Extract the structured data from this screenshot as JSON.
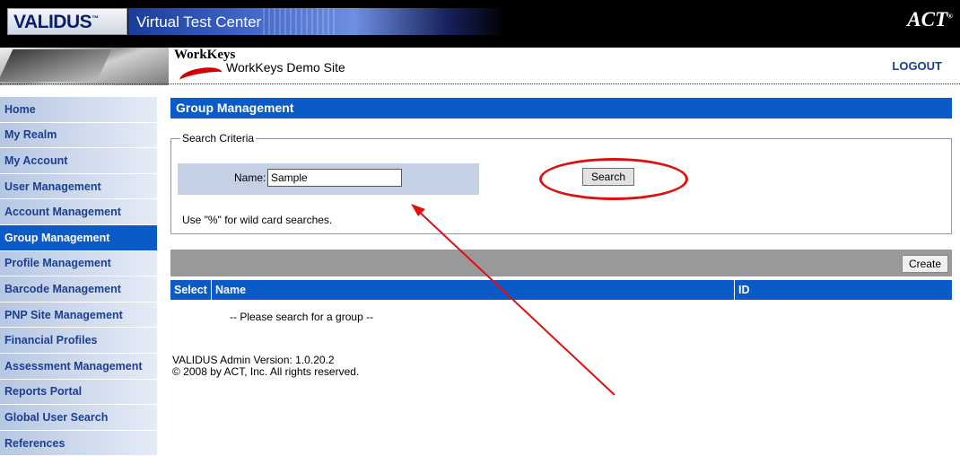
{
  "header": {
    "logo_text": "VALIDUS",
    "logo_tm": "™",
    "app_title": "Virtual Test Center",
    "act_logo": "ACT",
    "act_reg": "®",
    "brand": "WorkKeys",
    "site_name": "WorkKeys Demo Site",
    "logout_label": "LOGOUT"
  },
  "sidebar": {
    "items": [
      {
        "label": "Home"
      },
      {
        "label": "My Realm"
      },
      {
        "label": "My Account"
      },
      {
        "label": "User Management"
      },
      {
        "label": "Account Management"
      },
      {
        "label": "Group Management",
        "active": true
      },
      {
        "label": "Profile Management"
      },
      {
        "label": "Barcode Management"
      },
      {
        "label": "PNP Site Management"
      },
      {
        "label": "Financial Profiles"
      },
      {
        "label": "Assessment Management"
      },
      {
        "label": "Reports Portal"
      },
      {
        "label": "Global User Search"
      },
      {
        "label": "References"
      }
    ]
  },
  "main": {
    "page_title": "Group Management",
    "search": {
      "legend": "Search Criteria",
      "name_label": "Name:",
      "name_value": "Sample",
      "search_button": "Search",
      "wildcard_hint": "Use \"%\" for wild card searches."
    },
    "results": {
      "create_button": "Create",
      "columns": [
        "Select",
        "Name",
        "ID"
      ],
      "empty_message": "-- Please search for a group --"
    },
    "footer": {
      "version": "VALIDUS Admin Version: 1.0.20.2",
      "copyright": "© 2008 by ACT, Inc. All rights reserved."
    }
  },
  "colors": {
    "primary_blue": "#0a5ac8",
    "nav_text": "#1b3f94",
    "annotation_red": "#e01010",
    "toolbar_gray": "#999999"
  }
}
